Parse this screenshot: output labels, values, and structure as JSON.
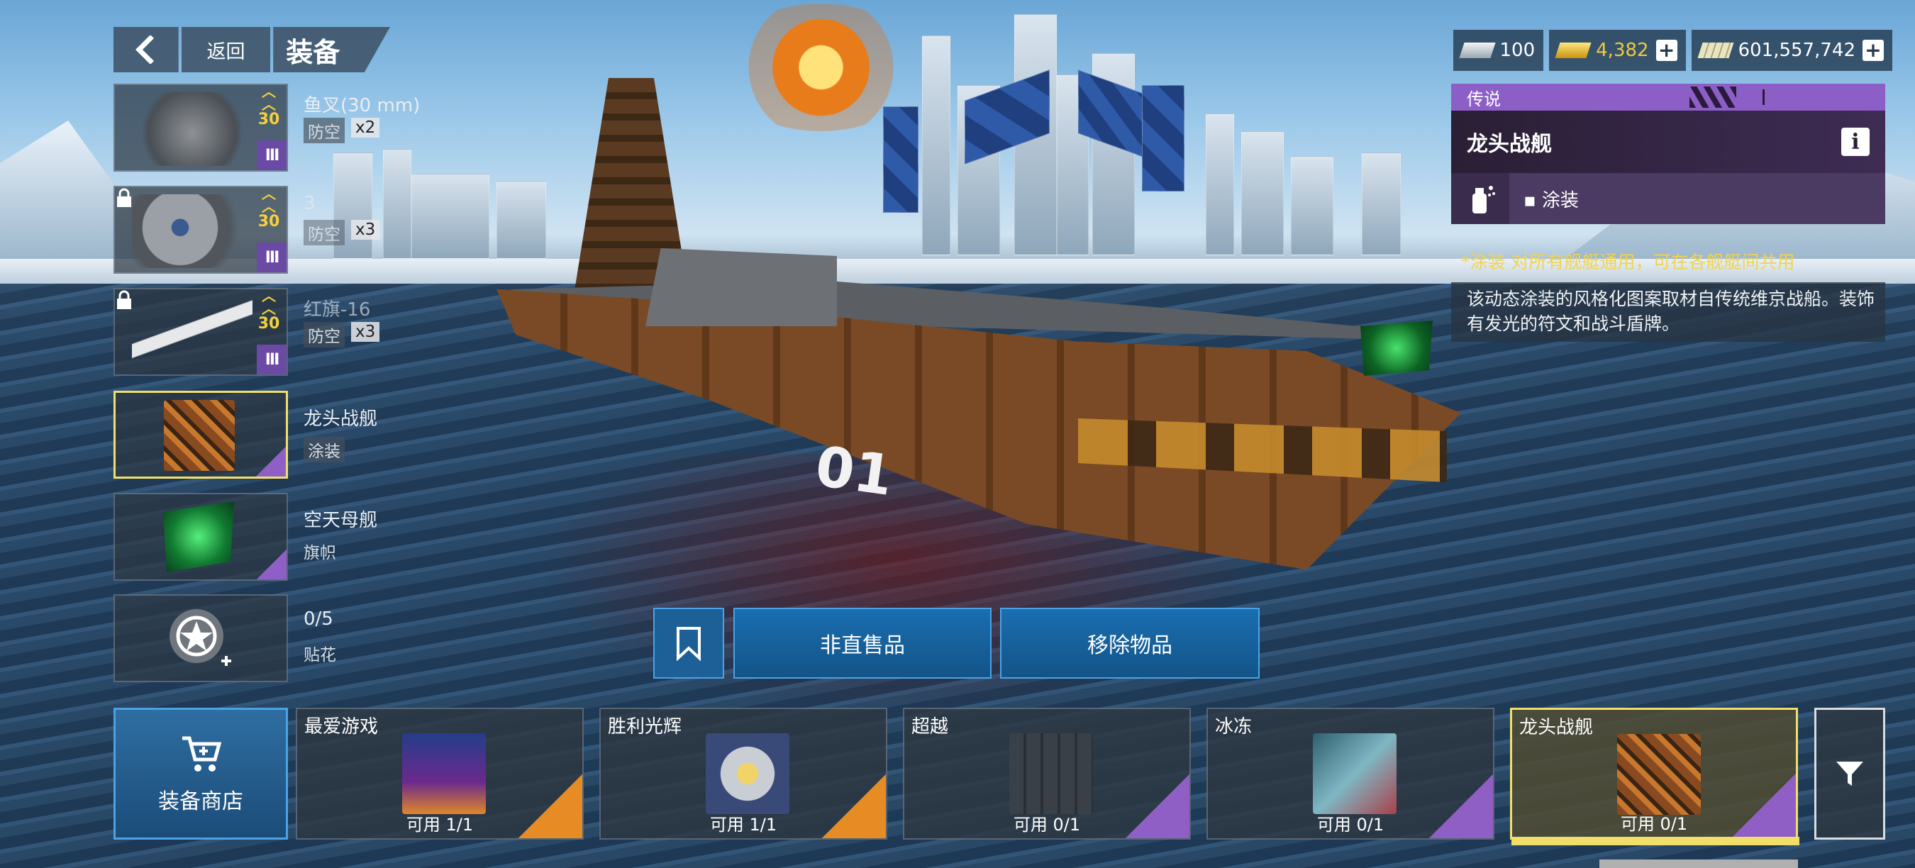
{
  "header": {
    "back_label": "返回",
    "title": "装备",
    "back_icon": "chevron-left-icon"
  },
  "currencies": [
    {
      "name": "silver",
      "value": "100",
      "color": "#cfd6dc",
      "has_plus": false
    },
    {
      "name": "gold",
      "value": "4,382",
      "color": "#f0c83a",
      "has_plus": true
    },
    {
      "name": "money",
      "value": "601,557,742",
      "color": "#d9d7b6",
      "has_plus": true
    }
  ],
  "equipment_slots": [
    {
      "name": "鱼叉(30 mm)",
      "type": "防空",
      "count": "x2",
      "level": "30",
      "locked": false
    },
    {
      "name": "3",
      "type": "防空",
      "count": "x3",
      "level": "30",
      "locked": true
    },
    {
      "name": "红旗-16",
      "type": "防空",
      "count": "x3",
      "level": "30",
      "locked": true
    }
  ],
  "cosmetic_slots": [
    {
      "name": "龙头战舰",
      "type": "涂装",
      "selected": true
    },
    {
      "name": "空天母舰",
      "type": "旗帜",
      "selected": false
    },
    {
      "name": "0/5",
      "type": "贴花",
      "selected": false
    }
  ],
  "actions": {
    "bookmark_icon": "bookmark-icon",
    "not_for_sale": "非直售品",
    "remove_item": "移除物品"
  },
  "info_panel": {
    "rarity": "传说",
    "skin_name": "龙头战舰",
    "info_icon": "i",
    "category": "▪ 涂装",
    "notice": "*涂装 对所有舰艇通用，可在各舰艇间共用",
    "description": "该动态涂装的风格化图案取材自传统维京战船。装饰有发光的符文和战斗盾牌。"
  },
  "scene": {
    "hull_number": "01"
  },
  "bottom_bar": {
    "shop_label": "装备商店",
    "collections": [
      {
        "name": "最爱游戏",
        "available": "可用 1/1",
        "corner_color": "#e78c25",
        "selected": false
      },
      {
        "name": "胜利光辉",
        "available": "可用 1/1",
        "corner_color": "#e78c25",
        "selected": false
      },
      {
        "name": "超越",
        "available": "可用 0/1",
        "corner_color": "#8f5fc5",
        "selected": false
      },
      {
        "name": "冰冻",
        "available": "可用 0/1",
        "corner_color": "#8f5fc5",
        "selected": false
      },
      {
        "name": "龙头战舰",
        "available": "可用 0/1",
        "corner_color": "#8f5fc5",
        "selected": true
      }
    ]
  },
  "colors": {
    "accent_blue": "#1a6eb0",
    "legendary_purple": "#8c5fc6",
    "selected_yellow": "#f1df6a",
    "level_gold": "#f3d03d"
  }
}
